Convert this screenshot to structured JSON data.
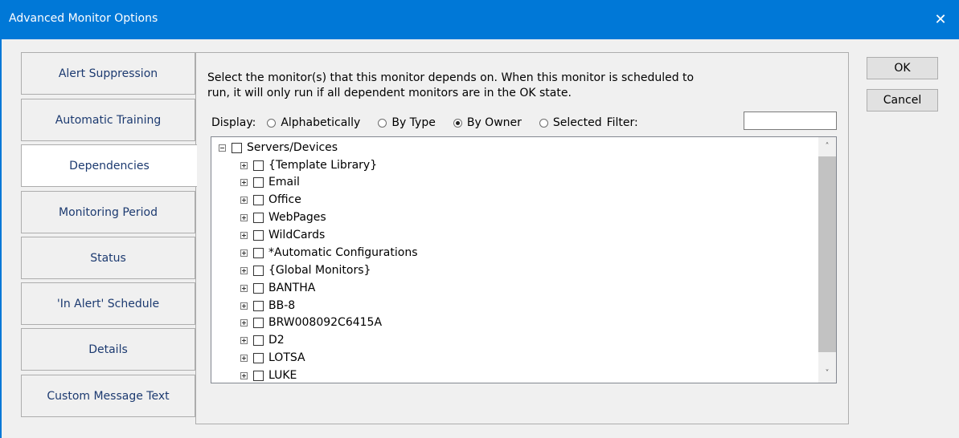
{
  "window": {
    "title": "Advanced Monitor Options",
    "close_glyph": "✕"
  },
  "sidebar": {
    "tabs": [
      {
        "label": "Alert Suppression",
        "active": false
      },
      {
        "label": "Automatic Training",
        "active": false
      },
      {
        "label": "Dependencies",
        "active": true
      },
      {
        "label": "Monitoring Period",
        "active": false
      },
      {
        "label": "Status",
        "active": false
      },
      {
        "label": "'In Alert' Schedule",
        "active": false
      },
      {
        "label": "Details",
        "active": false
      },
      {
        "label": "Custom Message Text",
        "active": false
      }
    ]
  },
  "dependencies": {
    "description_line1": "Select the monitor(s) that this monitor depends on.  When this monitor is scheduled to",
    "description_line2": "run, it will only run if all dependent monitors  are in the OK state.",
    "display_label": "Display:",
    "options": [
      {
        "label": "Alphabetically",
        "selected": false
      },
      {
        "label": "By Type",
        "selected": false
      },
      {
        "label": "By Owner",
        "selected": true
      },
      {
        "label": "Selected",
        "selected": false
      }
    ],
    "filter_label": "Filter:",
    "filter_value": "",
    "tree": {
      "root": "Servers/Devices",
      "children": [
        "{Template Library}",
        "Email",
        "Office",
        "WebPages",
        "WildCards",
        "*Automatic Configurations",
        "{Global Monitors}",
        "BANTHA",
        "BB-8",
        "BRW008092C6415A",
        "D2",
        "LOTSA",
        "LUKE"
      ]
    }
  },
  "buttons": {
    "ok": "OK",
    "cancel": "Cancel"
  },
  "icons": {
    "scroll_up": "chevron-up-icon",
    "scroll_down": "chevron-down-icon",
    "close": "close-icon"
  }
}
